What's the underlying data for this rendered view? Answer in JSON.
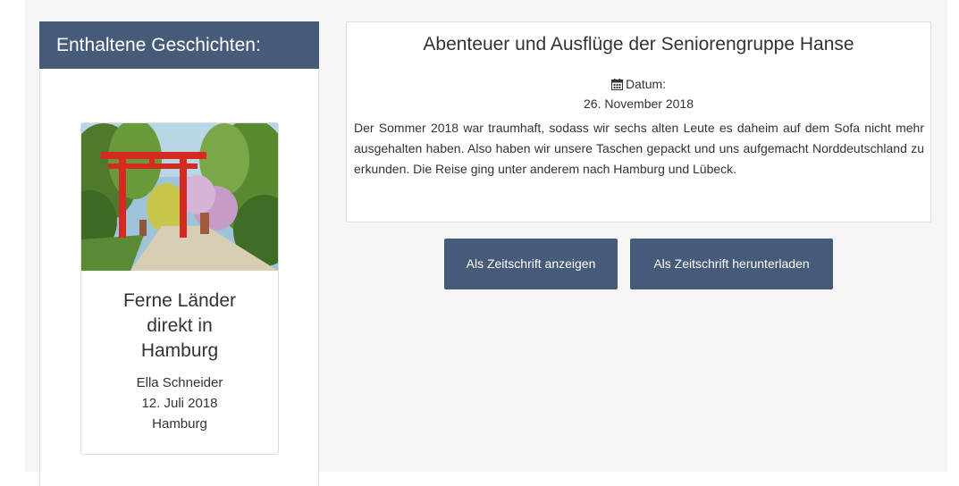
{
  "sidebar": {
    "header": "Enthaltene Geschichten:",
    "story": {
      "title": "Ferne Länder direkt in Hamburg",
      "author": "Ella Schneider",
      "date": "12. Juli 2018",
      "place": "Hamburg",
      "image": "red torii gate in a japanese garden"
    }
  },
  "main": {
    "title": "Abenteuer und Ausflüge der Seniorengruppe Hanse",
    "date_label": "Datum:",
    "date_icon": "calendar-icon",
    "date_value": "26. November 2018",
    "text": "Der Sommer 2018 war traumhaft, sodass wir sechs alten Leute es daheim auf dem Sofa nicht mehr ausgehalten haben. Also haben wir unsere Taschen gepackt und uns aufgemacht Norddeutschland zu erkunden. Die Reise ging unter anderem nach Hamburg und Lübeck."
  },
  "buttons": {
    "view_label": "Als Zeitschrift anzeigen",
    "download_label": "Als Zeitschrift herunterladen"
  },
  "colors": {
    "accent": "#465a7a",
    "background": "#f6f6f6"
  }
}
